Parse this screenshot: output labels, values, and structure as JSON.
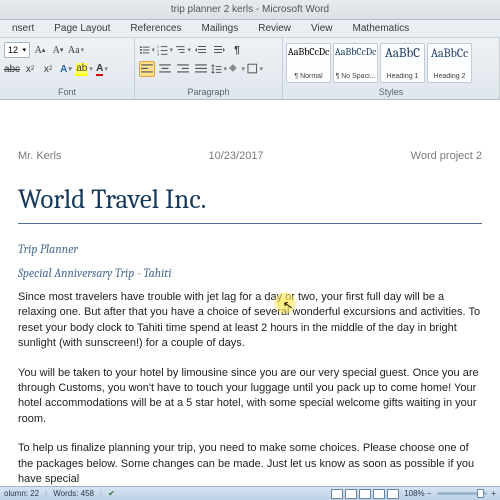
{
  "title": "trip planner 2 kerls - Microsoft Word",
  "tabs": {
    "t0": "nsert",
    "t1": "Page Layout",
    "t2": "References",
    "t3": "Mailings",
    "t4": "Review",
    "t5": "View",
    "t6": "Mathematics"
  },
  "font": {
    "size": "12",
    "label": "Font"
  },
  "paragraph": {
    "label": "Paragraph"
  },
  "styles": {
    "label": "Styles",
    "s0p": "AaBbCcDc",
    "s0n": "¶ Normal",
    "s1p": "AaBbCcDc",
    "s1n": "¶ No Spaci...",
    "s2p": "AaBbC",
    "s2n": "Heading 1",
    "s3p": "AaBbCc",
    "s3n": "Heading 2"
  },
  "doc": {
    "author": "Mr. Kerls",
    "date": "10/23/2017",
    "project": "Word project 2",
    "title": "World Travel Inc.",
    "sub1": "Trip Planner",
    "sub2": "Special Anniversary Trip - Tahiti",
    "p1": "Since most travelers have trouble with jet lag for a day or two, your first full day will be a relaxing one. But after that you have a choice of several wonderful excursions and activities. To reset your body clock to Tahiti time spend at least 2 hours in the middle of the day in bright sunlight (with sunscreen!) for a couple of days.",
    "p2": "You will be taken to your hotel by limousine since you are our very special guest. Once you are through Customs, you won't have to touch your luggage until you pack up to come home! Your hotel accommodations will be at a 5 star hotel, with some special welcome gifts waiting in your room.",
    "p3": "To help us finalize planning your trip, you need to make some choices. Please choose one of the packages below. Some changes can be made. Just let us know as soon as possible if you have special"
  },
  "status": {
    "col": "olumn: 22",
    "words": "Words: 458",
    "zoom": "108%"
  }
}
